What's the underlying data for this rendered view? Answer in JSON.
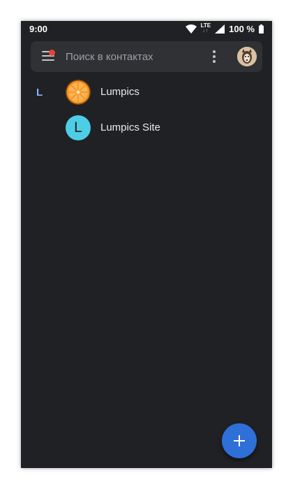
{
  "status_bar": {
    "time": "9:00",
    "network": "LTE",
    "battery": "100 %",
    "icons": [
      "wifi-icon",
      "lte-icon",
      "signal-icon",
      "battery-icon"
    ]
  },
  "search": {
    "placeholder": "Поиск в контактах",
    "menu_icon": "hamburger-menu-icon",
    "more_icon": "more-vertical-icon",
    "notification_badge_color": "#ea4335"
  },
  "contacts": {
    "section_letter": "L",
    "items": [
      {
        "name": "Lumpics",
        "avatar": "orange-slice-photo"
      },
      {
        "name": "Lumpics Site",
        "avatar_letter": "L",
        "avatar_color": "#4ecde6"
      }
    ]
  },
  "fab": {
    "icon": "plus-icon",
    "color": "#2f6fd8"
  },
  "colors": {
    "background": "#202124",
    "search_bar": "#303134",
    "section_letter": "#8ab4f8",
    "text": "#e8eaed"
  }
}
